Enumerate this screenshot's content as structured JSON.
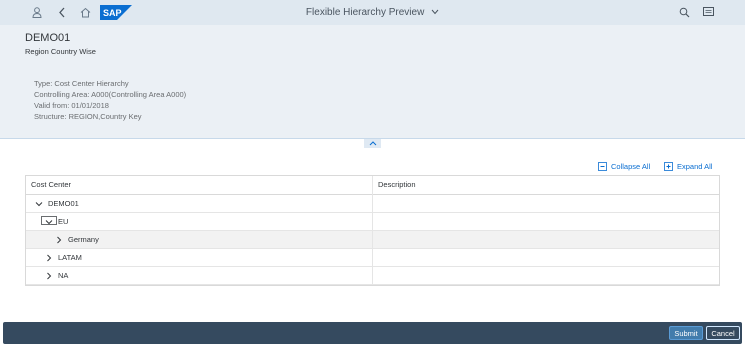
{
  "shell": {
    "title": "Flexible Hierarchy Preview",
    "logo_text": "SAP",
    "brand_color": "#0a6ed1",
    "icons": [
      "user-icon",
      "back-icon",
      "home-icon",
      "search-icon",
      "notifications-icon"
    ]
  },
  "header": {
    "title": "DEMO01",
    "subtitle": "Region Country Wise",
    "attributes": [
      "Type: Cost Center Hierarchy",
      "Controlling Area: A000(Controlling Area A000)",
      "Valid from: 01/01/2018",
      "Structure: REGION,Country Key"
    ]
  },
  "toolbar": {
    "collapse_all": "Collapse All",
    "expand_all": "Expand All"
  },
  "table": {
    "columns": [
      "Cost Center",
      "Description"
    ],
    "rows": [
      {
        "label": "DEMO01",
        "description": "",
        "expanded": true
      },
      {
        "label": "EU",
        "description": "",
        "expanded": true
      },
      {
        "label": "Germany",
        "description": "",
        "expanded": false
      },
      {
        "label": "LATAM",
        "description": "",
        "expanded": false
      },
      {
        "label": "NA",
        "description": "",
        "expanded": false
      }
    ]
  },
  "footer": {
    "submit": "Submit",
    "cancel": "Cancel"
  }
}
